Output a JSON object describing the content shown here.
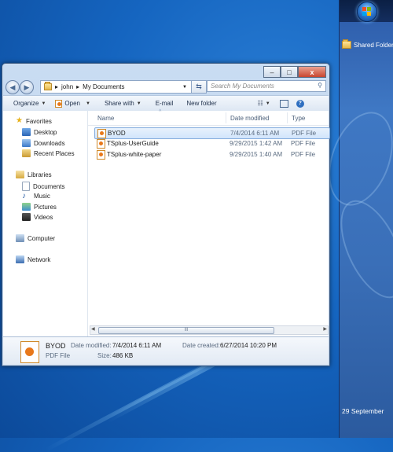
{
  "sidebar": {
    "shared_folder": "Shared Folder",
    "date": "29 September"
  },
  "window": {
    "caption": {
      "minimize": "▭",
      "maximize": "▭",
      "close": "x"
    },
    "address": {
      "segments": [
        "john",
        "My Documents"
      ]
    },
    "search": {
      "placeholder": "Search My Documents"
    },
    "toolbar": {
      "organize": "Organize",
      "open": "Open",
      "share_with": "Share with",
      "email": "E-mail",
      "new_folder": "New folder"
    },
    "nav": {
      "favorites": "Favorites",
      "desktop": "Desktop",
      "downloads": "Downloads",
      "recent_places": "Recent Places",
      "libraries": "Libraries",
      "documents": "Documents",
      "music": "Music",
      "pictures": "Pictures",
      "videos": "Videos",
      "computer": "Computer",
      "network": "Network"
    },
    "columns": {
      "name": "Name",
      "date_modified": "Date modified",
      "type": "Type"
    },
    "files": [
      {
        "name": "BYOD",
        "date": "7/4/2014 6:11 AM",
        "type": "PDF File"
      },
      {
        "name": "TSplus-UserGuide",
        "date": "9/29/2015 1:42 AM",
        "type": "PDF File"
      },
      {
        "name": "TSplus-white-paper",
        "date": "9/29/2015 1:40 AM",
        "type": "PDF File"
      }
    ],
    "scroll_thumb": "III",
    "details": {
      "name": "BYOD",
      "type": "PDF File",
      "date_modified_label": "Date modified:",
      "date_modified": "7/4/2014 6:11 AM",
      "size_label": "Size:",
      "size": "486 KB",
      "date_created_label": "Date created:",
      "date_created": "6/27/2014 10:20 PM"
    }
  }
}
